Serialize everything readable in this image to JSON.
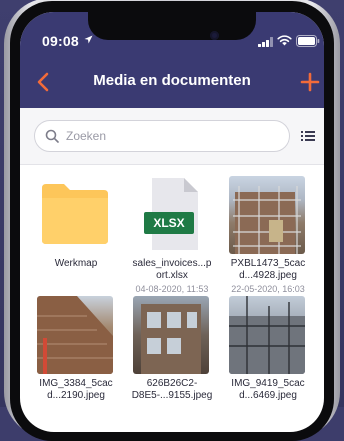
{
  "status_bar": {
    "time": "09:08"
  },
  "header": {
    "title": "Media en documenten"
  },
  "search": {
    "placeholder": "Zoeken"
  },
  "files": [
    {
      "name_line1": "Werkmap",
      "name_line2": "",
      "date": "",
      "kind": "folder"
    },
    {
      "name_line1": "sales_invoices...p",
      "name_line2": "ort.xlsx",
      "date": "04-08-2020, 11:53",
      "kind": "xlsx",
      "badge": "XLSX"
    },
    {
      "name_line1": "PXBL1473_5cac",
      "name_line2": "d...4928.jpeg",
      "date": "22-05-2020, 16:03",
      "kind": "photo"
    },
    {
      "name_line1": "IMG_3384_5cac",
      "name_line2": "d...2190.jpeg",
      "date": "",
      "kind": "photo"
    },
    {
      "name_line1": "626B26C2-",
      "name_line2": "D8E5-...9155.jpeg",
      "date": "",
      "kind": "photo"
    },
    {
      "name_line1": "IMG_9419_5cac",
      "name_line2": "d...6469.jpeg",
      "date": "",
      "kind": "photo"
    }
  ],
  "colors": {
    "header_bg": "#3a3a72",
    "accent": "#f26b3a",
    "folder": "#fdc65a",
    "xlsx": "#1f7a45"
  }
}
